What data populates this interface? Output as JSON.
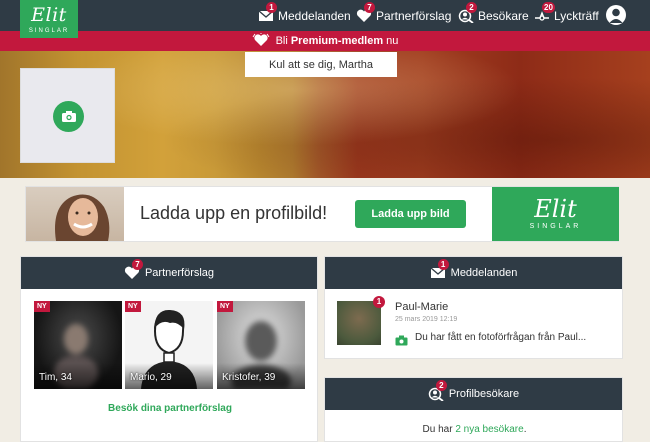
{
  "brand": {
    "logo_script": "Elit",
    "logo_sub": "SINGLAR"
  },
  "nav": {
    "items": [
      {
        "label": "Meddelanden",
        "badge": "1",
        "icon": "envelope-icon"
      },
      {
        "label": "Partnerförslag",
        "badge": "7",
        "icon": "heart-icon"
      },
      {
        "label": "Besökare",
        "badge": "2",
        "icon": "visitors-icon"
      },
      {
        "label": "Lyckträff",
        "badge": "20",
        "icon": "lucky-match-icon"
      }
    ],
    "account_icon": "user-avatar-icon"
  },
  "premium": {
    "prefix": "Bli",
    "highlight": "Premium-medlem",
    "suffix": "nu"
  },
  "welcome": "Kul att se dig, Martha",
  "banner": {
    "text": "Ladda upp en profilbild!",
    "button": "Ladda upp bild",
    "logo_script": "Elit",
    "logo_sub": "SINGLAR"
  },
  "partner": {
    "title": "Partnerförslag",
    "badge": "7",
    "new_label": "NY",
    "matches": [
      {
        "name": "Tim, 34"
      },
      {
        "name": "Mario, 29"
      },
      {
        "name": "Kristofer, 39"
      }
    ],
    "link": "Besök dina partnerförslag"
  },
  "messages": {
    "title": "Meddelanden",
    "badge": "1",
    "item": {
      "name": "Paul-Marie",
      "date": "25 mars 2019 12:19",
      "text": "Du har fått en fotoförfrågan från Paul...",
      "badge": "1"
    }
  },
  "visitors": {
    "title": "Profilbesökare",
    "badge": "2",
    "text_prefix": "Du har",
    "text_link": "2 nya besökare",
    "text_suffix": "."
  },
  "colors": {
    "nav": "#2f3b45",
    "accent": "#2fa85a",
    "premium": "#c2183d"
  }
}
